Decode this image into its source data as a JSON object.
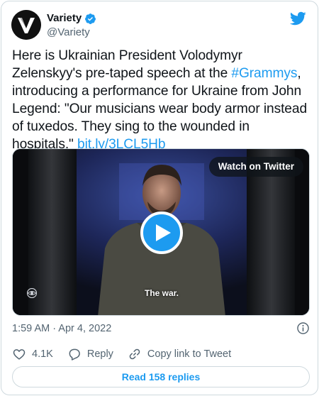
{
  "author": {
    "display_name": "Variety",
    "handle": "@Variety",
    "avatar_letter": "V"
  },
  "tweet": {
    "text_1": "Here is Ukrainian President Volodymyr Zelenskyy's pre-taped speech at the ",
    "hashtag": "#Grammys",
    "text_2": ", introducing a performance for Ukraine from John Legend: \"Our musicians wear body armor instead of tuxedos. They sing to the wounded in hospitals.\" ",
    "link": "bit.ly/3LCL5Hb"
  },
  "media": {
    "watch_label": "Watch on Twitter",
    "caption": "The war."
  },
  "meta": {
    "timestamp": "1:59 AM · Apr 4, 2022"
  },
  "actions": {
    "likes_count": "4.1K",
    "reply_label": "Reply",
    "copy_link_label": "Copy link to Tweet"
  },
  "replies_button": "Read 158 replies",
  "colors": {
    "accent": "#1d9bf0",
    "text": "#0f1419",
    "muted": "#536471",
    "border": "#cfd9de"
  },
  "icons": [
    "variety-logo-icon",
    "verified-badge-icon",
    "twitter-bird-icon",
    "play-icon",
    "cbs-eye-icon",
    "info-icon",
    "heart-icon",
    "reply-icon",
    "link-icon"
  ]
}
